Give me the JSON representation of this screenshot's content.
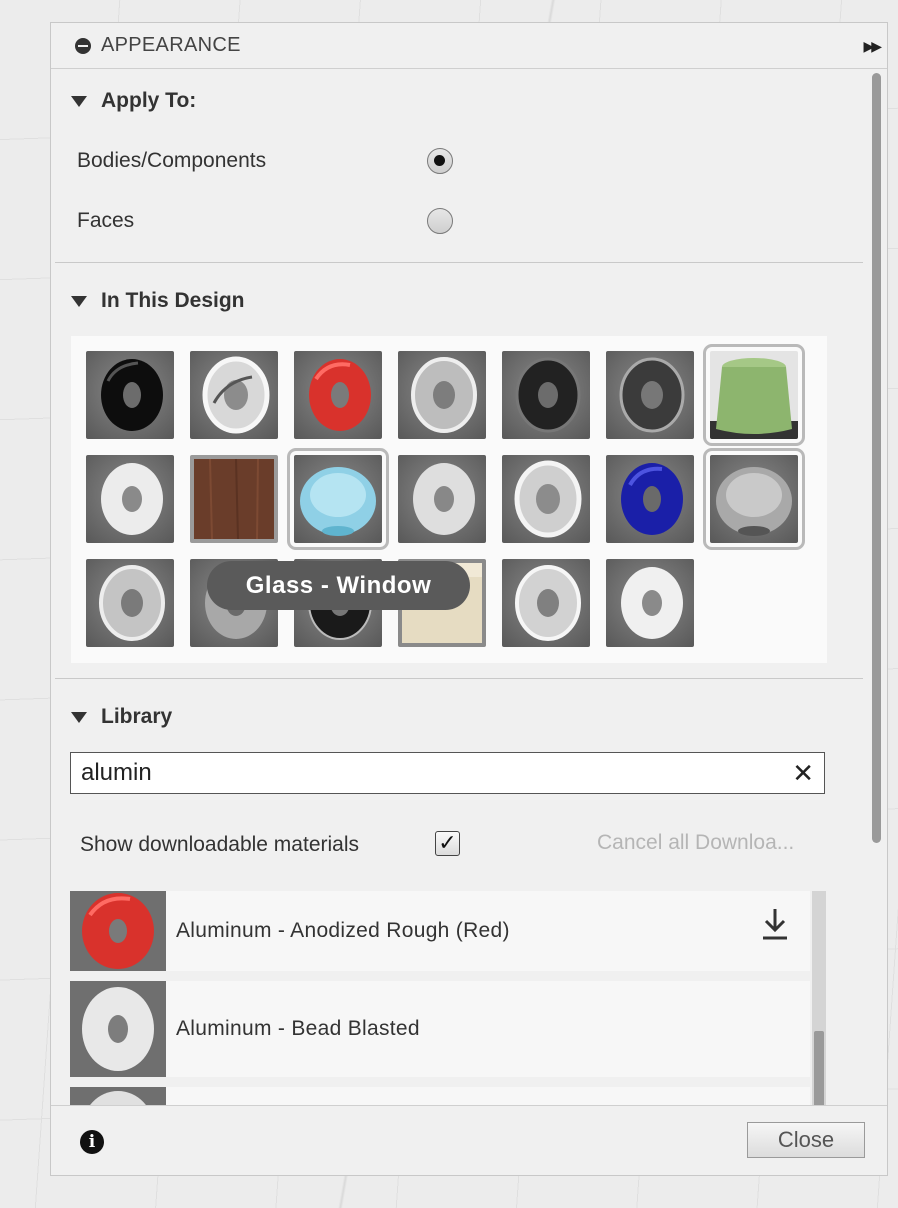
{
  "panel": {
    "title": "APPEARANCE"
  },
  "apply_to": {
    "heading": "Apply To:",
    "options": [
      {
        "label": "Bodies/Components",
        "checked": true
      },
      {
        "label": "Faces",
        "checked": false
      }
    ]
  },
  "in_this_design": {
    "heading": "In This Design",
    "tooltip": "Glass - Window",
    "swatches": [
      {
        "material": "black-plastic-ring"
      },
      {
        "material": "chrome-ring"
      },
      {
        "material": "red-plastic-ring"
      },
      {
        "material": "polished-metal-ring"
      },
      {
        "material": "dark-metal-ring"
      },
      {
        "material": "gunmetal-ring"
      },
      {
        "material": "green-fabric-cloth"
      },
      {
        "material": "white-ceramic-ring"
      },
      {
        "material": "walnut-wood-cube"
      },
      {
        "material": "blue-glass-bowl"
      },
      {
        "material": "brushed-silver-ring"
      },
      {
        "material": "mirror-chrome-ring"
      },
      {
        "material": "blue-plastic-ring"
      },
      {
        "material": "clear-glass-bowl"
      },
      {
        "material": "satin-metal-ring"
      },
      {
        "material": "grey-metal-ring"
      },
      {
        "material": "black-rubber-ring"
      },
      {
        "material": "beige-cube"
      },
      {
        "material": "aluminum-ring"
      },
      {
        "material": "white-matte-ring"
      }
    ]
  },
  "library": {
    "heading": "Library",
    "search_value": "alumin",
    "show_downloadable_label": "Show downloadable materials",
    "show_downloadable_checked": true,
    "cancel_downloads_label": "Cancel all Downloa...",
    "items": [
      {
        "label": "Aluminum - Anodized Rough (Red)",
        "thumb": "red-ring",
        "downloadable": true
      },
      {
        "label": "Aluminum - Bead Blasted",
        "thumb": "white-ring",
        "downloadable": false
      },
      {
        "label": "",
        "thumb": "white-ring",
        "downloadable": false
      }
    ]
  },
  "footer": {
    "close_label": "Close"
  },
  "colors": {
    "accent_selected_outline": "#b9b9b9",
    "tooltip_bg": "#5a5a5a"
  }
}
